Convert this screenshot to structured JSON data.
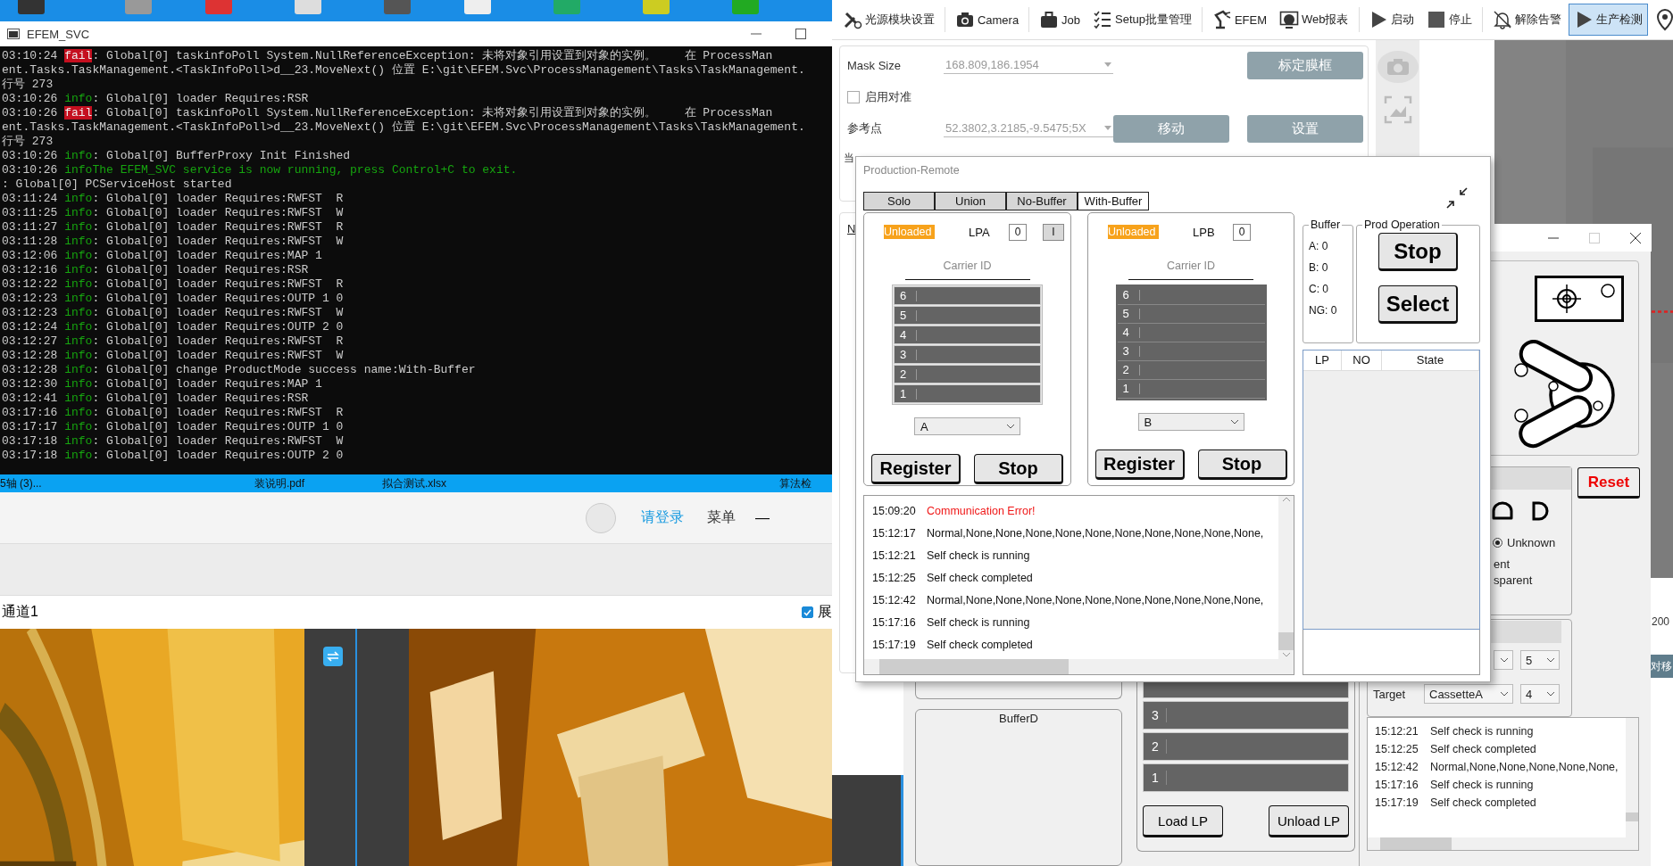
{
  "console": {
    "title": "EFEM_SVC",
    "lines": [
      {
        "kind": "error",
        "time": "03:10:24",
        "tag": "fail",
        "text": ": Global[0] taskinfoPoll System.NullReferenceException: 未将对象引用设置到对象的实例。    在 ProcessMan"
      },
      {
        "kind": "wrap",
        "text": "ent.Tasks.TaskManagement.<TaskInfoPoll>d__23.MoveNext() 位置 E:\\git\\EFEM.Svc\\ProcessManagement\\Tasks\\TaskManagement."
      },
      {
        "kind": "wrap",
        "text": "行号 273"
      },
      {
        "kind": "info",
        "time": "03:10:26",
        "tag": "info",
        "text": ": Global[0] loader Requires:RSR"
      },
      {
        "kind": "error",
        "time": "03:10:26",
        "tag": "fail",
        "text": ": Global[0] taskinfoPoll System.NullReferenceException: 未将对象引用设置到对象的实例。    在 ProcessMan"
      },
      {
        "kind": "wrap",
        "text": "ent.Tasks.TaskManagement.<TaskInfoPoll>d__23.MoveNext() 位置 E:\\git\\EFEM.Svc\\ProcessManagement\\Tasks\\TaskManagement."
      },
      {
        "kind": "wrap",
        "text": "行号 273"
      },
      {
        "kind": "info",
        "time": "03:10:26",
        "tag": "info",
        "text": ": Global[0] BufferProxy Init Finished"
      },
      {
        "kind": "notice",
        "time": "03:10:26",
        "tag": "info",
        "text": "The EFEM_SVC service is now running, press Control+C to exit."
      },
      {
        "kind": "wrap",
        "text": ": Global[0] PCServiceHost started"
      },
      {
        "kind": "info",
        "time": "03:11:24",
        "tag": "info",
        "text": ": Global[0] loader Requires:RWFST  R"
      },
      {
        "kind": "info",
        "time": "03:11:25",
        "tag": "info",
        "text": ": Global[0] loader Requires:RWFST  W"
      },
      {
        "kind": "info",
        "time": "03:11:27",
        "tag": "info",
        "text": ": Global[0] loader Requires:RWFST  R"
      },
      {
        "kind": "info",
        "time": "03:11:28",
        "tag": "info",
        "text": ": Global[0] loader Requires:RWFST  W"
      },
      {
        "kind": "info",
        "time": "03:12:06",
        "tag": "info",
        "text": ": Global[0] loader Requires:MAP 1"
      },
      {
        "kind": "info",
        "time": "03:12:16",
        "tag": "info",
        "text": ": Global[0] loader Requires:RSR"
      },
      {
        "kind": "info",
        "time": "03:12:22",
        "tag": "info",
        "text": ": Global[0] loader Requires:RWFST  R"
      },
      {
        "kind": "info",
        "time": "03:12:23",
        "tag": "info",
        "text": ": Global[0] loader Requires:OUTP 1 0"
      },
      {
        "kind": "info",
        "time": "03:12:23",
        "tag": "info",
        "text": ": Global[0] loader Requires:RWFST  W"
      },
      {
        "kind": "info",
        "time": "03:12:24",
        "tag": "info",
        "text": ": Global[0] loader Requires:OUTP 2 0"
      },
      {
        "kind": "info",
        "time": "03:12:27",
        "tag": "info",
        "text": ": Global[0] loader Requires:RWFST  R"
      },
      {
        "kind": "info",
        "time": "03:12:28",
        "tag": "info",
        "text": ": Global[0] loader Requires:RWFST  W"
      },
      {
        "kind": "info",
        "time": "03:12:28",
        "tag": "info",
        "text": ": Global[0] change ProductMode success name:With-Buffer"
      },
      {
        "kind": "info",
        "time": "03:12:30",
        "tag": "info",
        "text": ": Global[0] loader Requires:MAP 1"
      },
      {
        "kind": "info",
        "time": "03:12:41",
        "tag": "info",
        "text": ": Global[0] loader Requires:RSR"
      },
      {
        "kind": "info",
        "time": "03:17:16",
        "tag": "info",
        "text": ": Global[0] loader Requires:RWFST  R"
      },
      {
        "kind": "info",
        "time": "03:17:17",
        "tag": "info",
        "text": ": Global[0] loader Requires:OUTP 1 0"
      },
      {
        "kind": "info",
        "time": "03:17:18",
        "tag": "info",
        "text": ": Global[0] loader Requires:RWFST  W"
      },
      {
        "kind": "info",
        "time": "03:17:18",
        "tag": "info",
        "text": ": Global[0] loader Requires:OUTP 2 0"
      }
    ]
  },
  "file_strip": [
    {
      "label": "5轴 (3)..."
    },
    {
      "label": "装说明.pdf"
    },
    {
      "label": "拟合测试.xlsx"
    },
    {
      "label": "算法检"
    }
  ],
  "video_client": {
    "login": "请登录",
    "menu": "菜单",
    "minimize": "—",
    "channel": "通道1",
    "show_checkbox": {
      "label": "展",
      "checked": true
    },
    "feeds": [
      {
        "kind": "picture"
      },
      {
        "kind": "picture"
      }
    ]
  },
  "main_app": {
    "toolbar": [
      {
        "label": "光源模块设置",
        "selected": false
      },
      {
        "label": "Camera",
        "selected": false
      },
      {
        "label": "Job",
        "selected": false
      },
      {
        "label": "Setup批量管理",
        "selected": false
      },
      {
        "label": "EFEM",
        "selected": false
      },
      {
        "label": "Web报表",
        "selected": false
      },
      {
        "label": "启动",
        "selected": false
      },
      {
        "label": "停止",
        "selected": false
      },
      {
        "label": "解除告警",
        "selected": false
      },
      {
        "label": "生产检测",
        "selected": true
      }
    ],
    "mask_size": {
      "label": "Mask Size",
      "value": "168.809,186.1954"
    },
    "calibrate_button": {
      "label": "标定膜框",
      "disabled": true
    },
    "align_checkbox": {
      "label": "启用对准",
      "checked": false
    },
    "reference": {
      "label": "参考点",
      "value": "52.3802,3.2185,-9.5475;5X"
    },
    "move_button": {
      "label": "移动",
      "disabled": true
    },
    "set_button": {
      "label": "设置",
      "disabled": true
    },
    "row_label": "当",
    "link": "N",
    "image": {
      "kind": "picture"
    },
    "edge_value": "200",
    "edge_button": "对移",
    "buffer_d": "BufferD",
    "slots": [
      "3",
      "2",
      "1"
    ],
    "load_button": "Load LP",
    "unload_button": "Unload LP"
  },
  "production_remote": {
    "title": "Production-Remote",
    "modes": [
      {
        "label": "Solo",
        "selected": false
      },
      {
        "label": "Union",
        "selected": false
      },
      {
        "label": "No-Buffer",
        "selected": false
      },
      {
        "label": "With-Buffer",
        "selected": true
      }
    ],
    "load_ports": [
      {
        "status": "Unloaded",
        "name": "LPA",
        "count": "0",
        "indicator": "I",
        "carrier_label": "Carrier ID",
        "slots": [
          "6",
          "5",
          "4",
          "3",
          "2",
          "1"
        ],
        "cassette": "A",
        "register": "Register",
        "stop": "Stop"
      },
      {
        "status": "Unloaded",
        "name": "LPB",
        "count": "0",
        "carrier_label": "Carrier ID",
        "slots": [
          "6",
          "5",
          "4",
          "3",
          "2",
          "1"
        ],
        "cassette": "B",
        "register": "Register",
        "stop": "Stop"
      }
    ],
    "buffer": {
      "title": "Buffer",
      "counts": [
        "A: 0",
        "B: 0",
        "C: 0",
        "NG: 0"
      ]
    },
    "prod_operation": {
      "title": "Prod Operation",
      "buttons": [
        "Stop",
        "Select"
      ]
    },
    "table": {
      "columns": [
        "LP",
        "NO",
        "State"
      ]
    },
    "log": [
      {
        "kind": "error",
        "time": "15:09:20",
        "text": "Communication Error!"
      },
      {
        "kind": "info",
        "time": "15:12:17",
        "text": "Normal,None,None,None,None,None,None,None,None,None,None,"
      },
      {
        "kind": "info",
        "time": "15:12:21",
        "text": "Self check is running"
      },
      {
        "kind": "info",
        "time": "15:12:25",
        "text": "Self check completed"
      },
      {
        "kind": "info",
        "time": "15:12:42",
        "text": "Normal,None,None,None,None,None,None,None,None,None,None,"
      },
      {
        "kind": "info",
        "time": "15:17:16",
        "text": "Self check is running"
      },
      {
        "kind": "info",
        "time": "15:17:19",
        "text": "Self check completed"
      }
    ]
  },
  "wafer_window": {
    "reset": "Reset",
    "radio": {
      "label": "Unknown",
      "selected": true
    },
    "material_texts": [
      "ent",
      "sparent"
    ],
    "slot_value": "5",
    "target_label": "Target",
    "target_value": "CassetteA",
    "target_slot": "4",
    "log": [
      {
        "time": "15:12:21",
        "text": "Self check is running"
      },
      {
        "time": "15:12:25",
        "text": "Self check completed"
      },
      {
        "time": "15:12:42",
        "text": "Normal,None,None,None,None,None,"
      },
      {
        "time": "15:17:16",
        "text": "Self check is running"
      },
      {
        "time": "15:17:19",
        "text": "Self check completed"
      }
    ]
  }
}
